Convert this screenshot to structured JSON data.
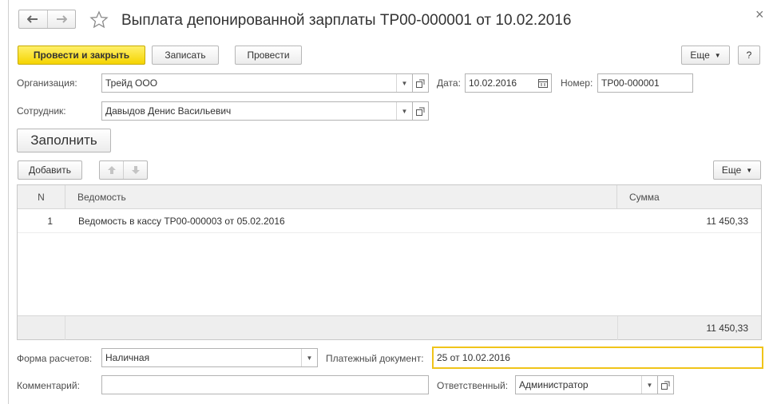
{
  "window": {
    "title": "Выплата депонированной зарплаты ТР00-000001 от 10.02.2016",
    "close_glyph": "×"
  },
  "toolbar": {
    "post_close": "Провести и закрыть",
    "save": "Записать",
    "post": "Провести",
    "more": "Еще",
    "help": "?"
  },
  "org": {
    "label": "Организация:",
    "value": "Трейд ООО"
  },
  "date": {
    "label": "Дата:",
    "value": "10.02.2016"
  },
  "number": {
    "label": "Номер:",
    "value": "ТР00-000001"
  },
  "employee": {
    "label": "Сотрудник:",
    "value": "Давыдов Денис Васильевич"
  },
  "fill_button": "Заполнить",
  "table_toolbar": {
    "add": "Добавить",
    "more": "Еще"
  },
  "table": {
    "columns": [
      "N",
      "Ведомость",
      "Сумма"
    ],
    "rows": [
      {
        "n": "1",
        "statement": "Ведомость в кассу ТР00-000003 от 05.02.2016",
        "sum": "11 450,33"
      }
    ],
    "footer_sum": "11 450,33"
  },
  "payment_form": {
    "label": "Форма расчетов:",
    "value": "Наличная"
  },
  "payment_doc": {
    "label": "Платежный документ:",
    "value": "25 от 10.02.2016"
  },
  "comment": {
    "label": "Комментарий:",
    "value": ""
  },
  "responsible": {
    "label": "Ответственный:",
    "value": "Администратор"
  },
  "colors": {
    "accent": "#f5d400",
    "focus": "#f0c419",
    "border": "#b3b3b3"
  }
}
